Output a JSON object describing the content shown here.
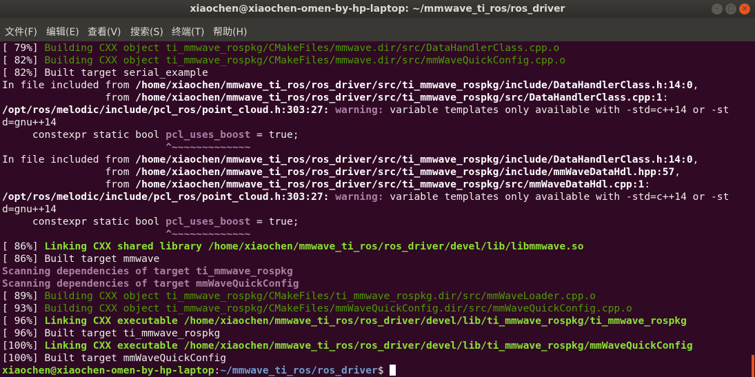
{
  "window": {
    "title": "xiaochen@xiaochen-omen-by-hp-laptop: ~/mmwave_ti_ros/ros_driver",
    "minimize_glyph": "–",
    "maximize_glyph": "□",
    "close_glyph": "×"
  },
  "menu": {
    "file": "文件(F)",
    "edit": "编辑(E)",
    "view": "查看(V)",
    "search": "搜索(S)",
    "terminal": "终端(T)",
    "help": "帮助(H)"
  },
  "terminal": {
    "lines": [
      [
        {
          "t": "[ 79%] ",
          "c": ""
        },
        {
          "t": "Building CXX object ti_mmwave_rospkg/CMakeFiles/mmwave.dir/src/DataHandlerClass.cpp.o",
          "c": "g"
        }
      ],
      [
        {
          "t": "[ 82%] ",
          "c": ""
        },
        {
          "t": "Building CXX object ti_mmwave_rospkg/CMakeFiles/mmwave.dir/src/mmWaveQuickConfig.cpp.o",
          "c": "g"
        }
      ],
      [
        {
          "t": "[ 82%] Built target serial_example",
          "c": ""
        }
      ],
      [
        {
          "t": "In file included from ",
          "c": ""
        },
        {
          "t": "/home/xiaochen/mmwave_ti_ros/ros_driver/src/ti_mmwave_rospkg/include/DataHandlerClass.h:14:0",
          "c": "w"
        },
        {
          "t": ",",
          "c": ""
        }
      ],
      [
        {
          "t": "                 from ",
          "c": ""
        },
        {
          "t": "/home/xiaochen/mmwave_ti_ros/ros_driver/src/ti_mmwave_rospkg/src/DataHandlerClass.cpp:1",
          "c": "w"
        },
        {
          "t": ":",
          "c": ""
        }
      ],
      [
        {
          "t": "/opt/ros/melodic/include/pcl_ros/point_cloud.h:303:27:",
          "c": "w"
        },
        {
          "t": " ",
          "c": ""
        },
        {
          "t": "warning:",
          "c": "m"
        },
        {
          "t": " variable templates only available with -std=c++14 or -st",
          "c": ""
        }
      ],
      [
        {
          "t": "d=gnu++14",
          "c": ""
        }
      ],
      [
        {
          "t": "     constexpr static bool ",
          "c": ""
        },
        {
          "t": "pcl_uses_boost",
          "c": "m"
        },
        {
          "t": " = true;",
          "c": ""
        }
      ],
      [
        {
          "t": "                           ",
          "c": ""
        },
        {
          "t": "^~~~~~~~~~~~~~",
          "c": "m"
        }
      ],
      [
        {
          "t": "In file included from ",
          "c": ""
        },
        {
          "t": "/home/xiaochen/mmwave_ti_ros/ros_driver/src/ti_mmwave_rospkg/include/DataHandlerClass.h:14:0",
          "c": "w"
        },
        {
          "t": ",",
          "c": ""
        }
      ],
      [
        {
          "t": "                 from ",
          "c": ""
        },
        {
          "t": "/home/xiaochen/mmwave_ti_ros/ros_driver/src/ti_mmwave_rospkg/include/mmWaveDataHdl.hpp:57",
          "c": "w"
        },
        {
          "t": ",",
          "c": ""
        }
      ],
      [
        {
          "t": "                 from ",
          "c": ""
        },
        {
          "t": "/home/xiaochen/mmwave_ti_ros/ros_driver/src/ti_mmwave_rospkg/src/mmWaveDataHdl.cpp:1",
          "c": "w"
        },
        {
          "t": ":",
          "c": ""
        }
      ],
      [
        {
          "t": "/opt/ros/melodic/include/pcl_ros/point_cloud.h:303:27:",
          "c": "w"
        },
        {
          "t": " ",
          "c": ""
        },
        {
          "t": "warning:",
          "c": "m"
        },
        {
          "t": " variable templates only available with -std=c++14 or -st",
          "c": ""
        }
      ],
      [
        {
          "t": "d=gnu++14",
          "c": ""
        }
      ],
      [
        {
          "t": "     constexpr static bool ",
          "c": ""
        },
        {
          "t": "pcl_uses_boost",
          "c": "m"
        },
        {
          "t": " = true;",
          "c": ""
        }
      ],
      [
        {
          "t": "                           ",
          "c": ""
        },
        {
          "t": "^~~~~~~~~~~~~~",
          "c": "m"
        }
      ],
      [
        {
          "t": "[ 86%] ",
          "c": ""
        },
        {
          "t": "Linking CXX shared library /home/xiaochen/mmwave_ti_ros/ros_driver/devel/lib/libmmwave.so",
          "c": "gb"
        }
      ],
      [
        {
          "t": "[ 86%] Built target mmwave",
          "c": ""
        }
      ],
      [
        {
          "t": "Scanning dependencies of target ti_mmwave_rospkg",
          "c": "m"
        }
      ],
      [
        {
          "t": "Scanning dependencies of target mmWaveQuickConfig",
          "c": "m"
        }
      ],
      [
        {
          "t": "[ 89%] ",
          "c": ""
        },
        {
          "t": "Building CXX object ti_mmwave_rospkg/CMakeFiles/ti_mmwave_rospkg.dir/src/mmWaveLoader.cpp.o",
          "c": "g"
        }
      ],
      [
        {
          "t": "[ 93%] ",
          "c": ""
        },
        {
          "t": "Building CXX object ti_mmwave_rospkg/CMakeFiles/mmWaveQuickConfig.dir/src/mmWaveQuickConfig.cpp.o",
          "c": "g"
        }
      ],
      [
        {
          "t": "[ 96%] ",
          "c": ""
        },
        {
          "t": "Linking CXX executable /home/xiaochen/mmwave_ti_ros/ros_driver/devel/lib/ti_mmwave_rospkg/ti_mmwave_rospkg",
          "c": "gb"
        }
      ],
      [
        {
          "t": "[ 96%] Built target ti_mmwave_rospkg",
          "c": ""
        }
      ],
      [
        {
          "t": "[100%] ",
          "c": ""
        },
        {
          "t": "Linking CXX executable /home/xiaochen/mmwave_ti_ros/ros_driver/devel/lib/ti_mmwave_rospkg/mmWaveQuickConfig",
          "c": "gb"
        }
      ],
      [
        {
          "t": "[100%] Built target mmWaveQuickConfig",
          "c": ""
        }
      ]
    ],
    "prompt": {
      "user_host": "xiaochen@xiaochen-omen-by-hp-laptop",
      "sep": ":",
      "path": "~/mmwave_ti_ros/ros_driver",
      "symbol": "$ "
    }
  },
  "colors": {
    "background": "#300a24",
    "green": "#4e9a06",
    "bright_green": "#8ae234",
    "magenta": "#ad7fa8",
    "blue": "#729fcf",
    "scroll_thumb": "#e95420"
  }
}
